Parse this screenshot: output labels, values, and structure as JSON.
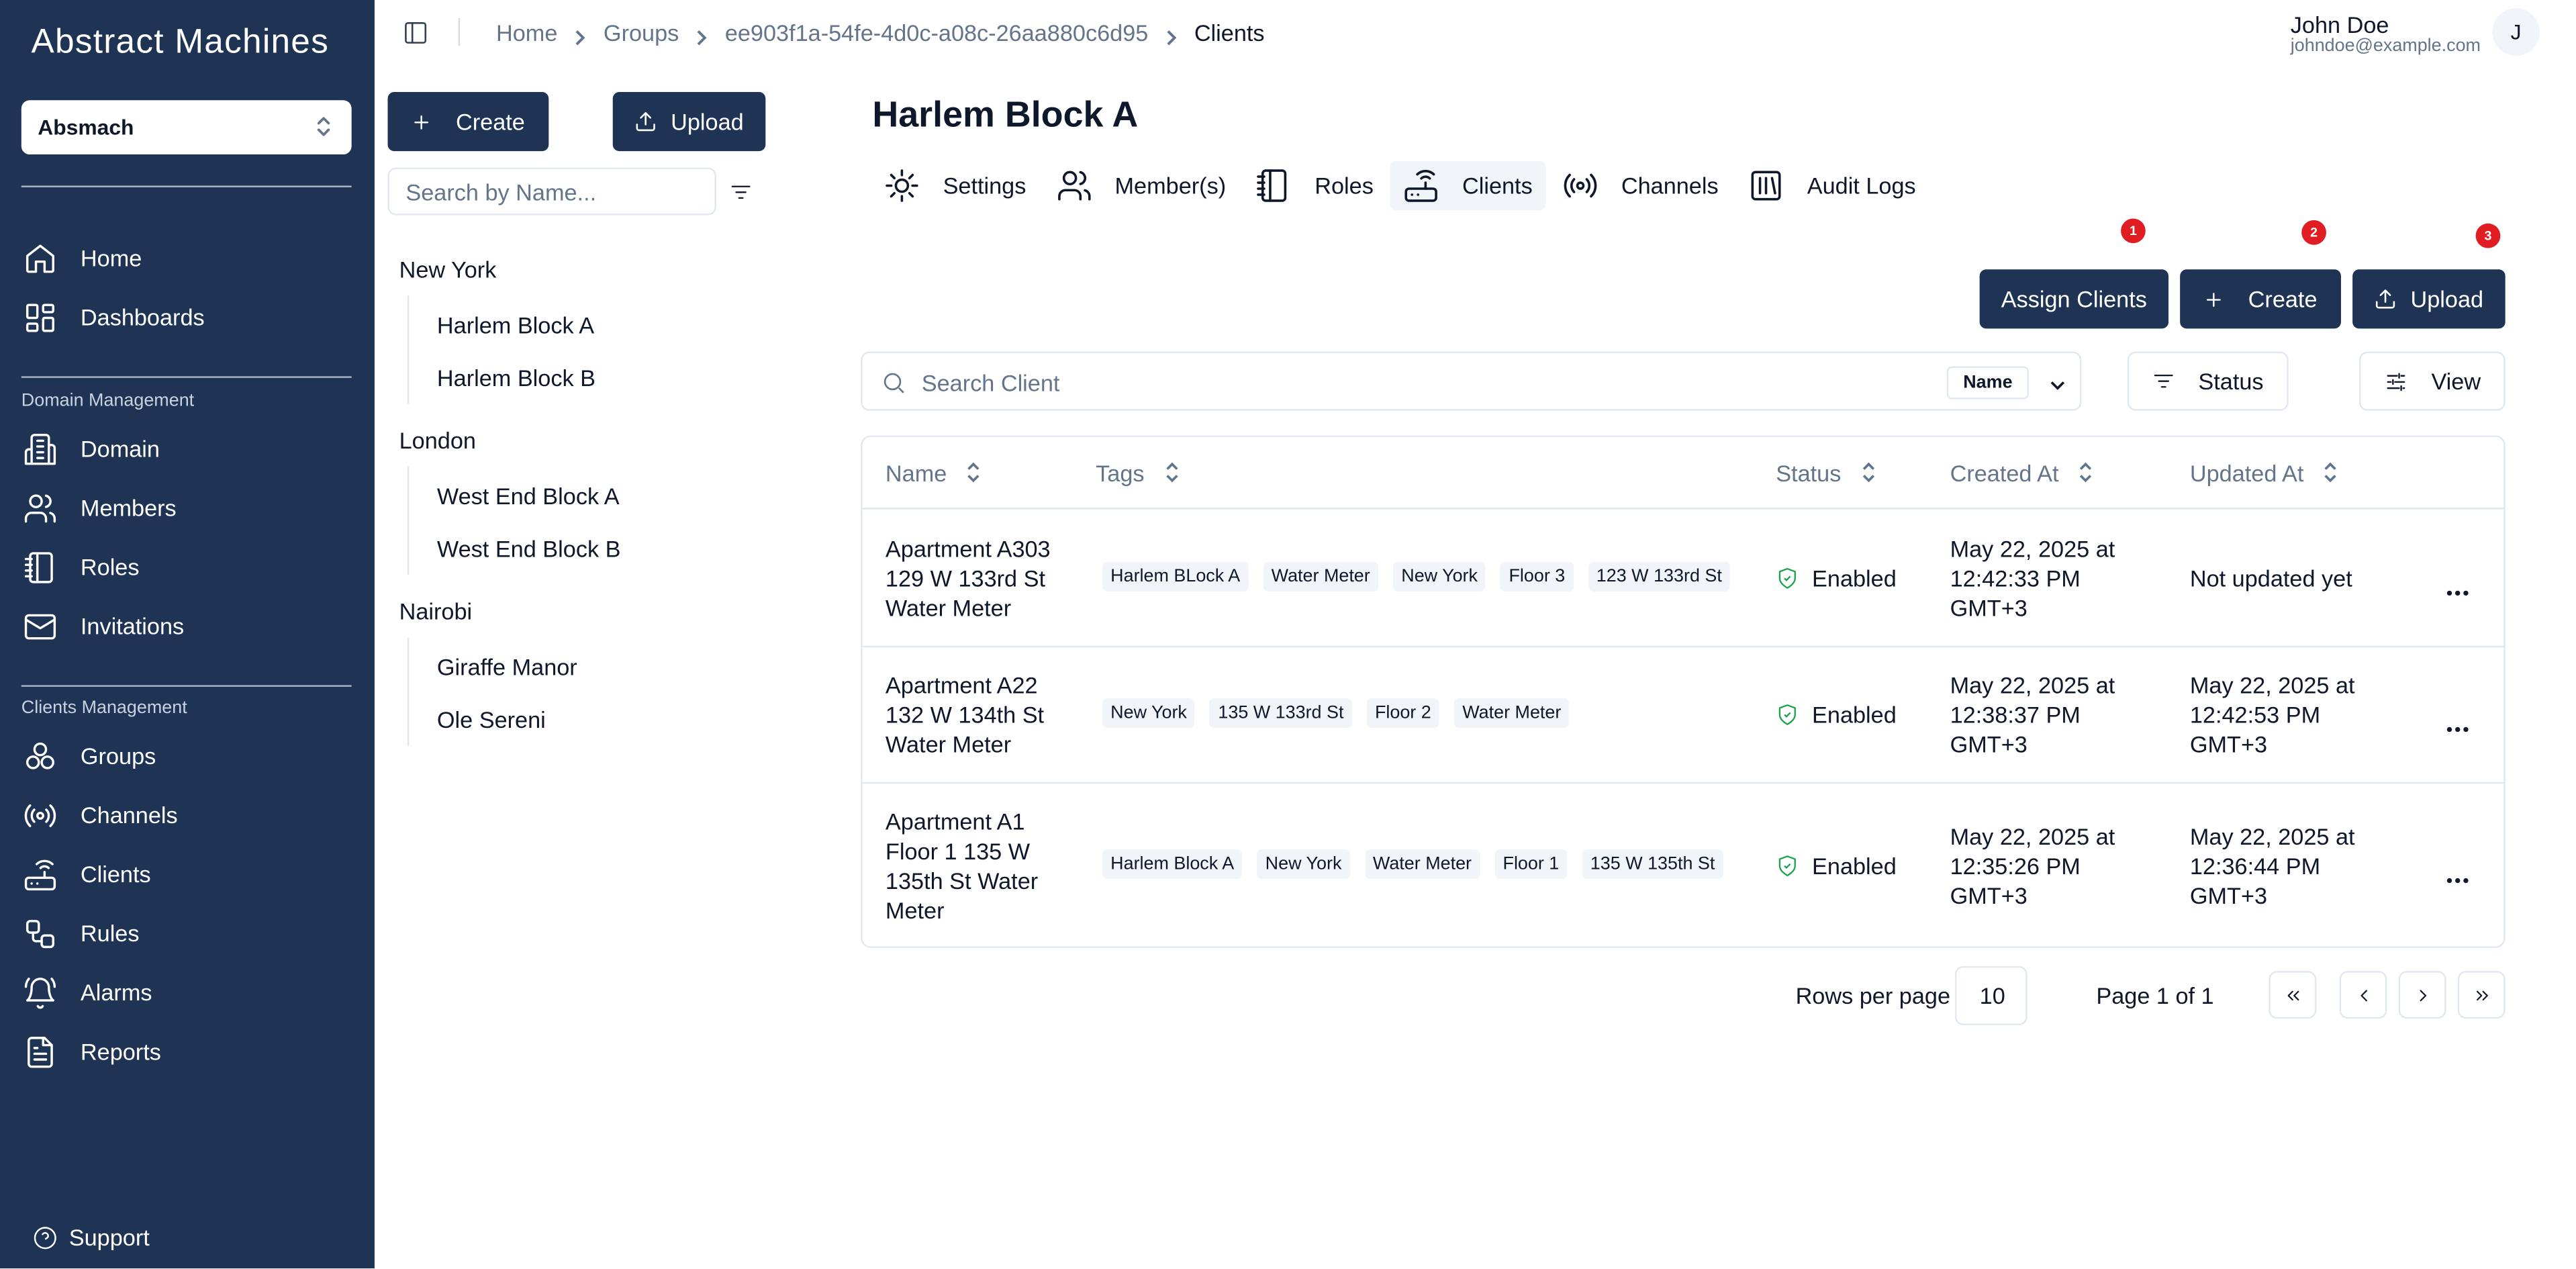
{
  "app": {
    "logo": "Abstract Machines",
    "workspace": "Absmach"
  },
  "sidebar": {
    "top_items": [
      {
        "label": "Home",
        "icon": "home-icon"
      },
      {
        "label": "Dashboards",
        "icon": "dashboard-icon"
      }
    ],
    "domain_section_label": "Domain Management",
    "domain_items": [
      {
        "label": "Domain",
        "icon": "building-icon"
      },
      {
        "label": "Members",
        "icon": "users-icon"
      },
      {
        "label": "Roles",
        "icon": "notebook-icon"
      },
      {
        "label": "Invitations",
        "icon": "mail-icon"
      }
    ],
    "clients_section_label": "Clients Management",
    "clients_items": [
      {
        "label": "Groups",
        "icon": "groups-icon"
      },
      {
        "label": "Channels",
        "icon": "radio-icon"
      },
      {
        "label": "Clients",
        "icon": "router-icon"
      },
      {
        "label": "Rules",
        "icon": "workflow-icon"
      },
      {
        "label": "Alarms",
        "icon": "bell-icon"
      },
      {
        "label": "Reports",
        "icon": "file-text-icon"
      }
    ],
    "support_label": "Support"
  },
  "breadcrumb": {
    "items": [
      "Home",
      "Groups",
      "ee903f1a-54fe-4d0c-a08c-26aa880c6d95"
    ],
    "current": "Clients"
  },
  "user": {
    "name": "John Doe",
    "email": "johndoe@example.com",
    "initial": "J"
  },
  "groups_panel": {
    "create_label": "Create",
    "upload_label": "Upload",
    "search_placeholder": "Search by Name...",
    "tree": [
      {
        "name": "New York",
        "children": [
          "Harlem Block A",
          "Harlem Block B"
        ]
      },
      {
        "name": "London",
        "children": [
          "West End Block A",
          "West End Block B"
        ]
      },
      {
        "name": "Nairobi",
        "children": [
          "Giraffe Manor",
          "Ole Sereni"
        ]
      }
    ]
  },
  "main": {
    "title": "Harlem Block A",
    "tabs": [
      {
        "label": "Settings",
        "icon": "gear-icon"
      },
      {
        "label": "Member(s)",
        "icon": "users-icon"
      },
      {
        "label": "Roles",
        "icon": "notebook-icon"
      },
      {
        "label": "Clients",
        "icon": "router-icon",
        "active": true
      },
      {
        "label": "Channels",
        "icon": "radio-icon"
      },
      {
        "label": "Audit Logs",
        "icon": "logs-icon"
      }
    ],
    "actions": {
      "assign_label": "Assign Clients",
      "create_label": "Create",
      "upload_label": "Upload",
      "badges": [
        "1",
        "2",
        "3"
      ]
    },
    "search": {
      "placeholder": "Search Client",
      "field": "Name"
    },
    "status_filter_label": "Status",
    "view_label": "View",
    "table": {
      "columns": [
        "Name",
        "Tags",
        "Status",
        "Created At",
        "Updated At"
      ],
      "rows": [
        {
          "name": [
            "Apartment A303",
            "129 W 133rd St",
            "Water Meter"
          ],
          "tags": [
            "Harlem BLock A",
            "Water Meter",
            "New York",
            "Floor 3",
            "123 W 133rd St"
          ],
          "status": "Enabled",
          "created": [
            "May 22, 2025 at",
            "12:42:33 PM",
            "GMT+3"
          ],
          "updated": [
            "Not updated yet"
          ]
        },
        {
          "name": [
            "Apartment A22",
            "132 W 134th St",
            "Water Meter"
          ],
          "tags": [
            "New York",
            "135 W 133rd St",
            "Floor 2",
            "Water Meter"
          ],
          "status": "Enabled",
          "created": [
            "May 22, 2025 at",
            "12:38:37 PM",
            "GMT+3"
          ],
          "updated": [
            "May 22, 2025 at",
            "12:42:53 PM",
            "GMT+3"
          ]
        },
        {
          "name": [
            "Apartment A1",
            "Floor 1 135 W",
            "135th St Water",
            "Meter"
          ],
          "tags": [
            "Harlem Block A",
            "New York",
            "Water Meter",
            "Floor 1",
            "135 W 135th St"
          ],
          "status": "Enabled",
          "created": [
            "May 22, 2025 at",
            "12:35:26 PM",
            "GMT+3"
          ],
          "updated": [
            "May 22, 2025 at",
            "12:36:44 PM",
            "GMT+3"
          ]
        }
      ]
    },
    "pagination": {
      "rows_per_page_label": "Rows per page",
      "rows_per_page": "10",
      "page_info": "Page 1 of 1"
    }
  },
  "colors": {
    "sidebar_bg": "#1f3354",
    "primary": "#1f3354",
    "badge": "#e11d24",
    "status_ok": "#16a34a"
  }
}
